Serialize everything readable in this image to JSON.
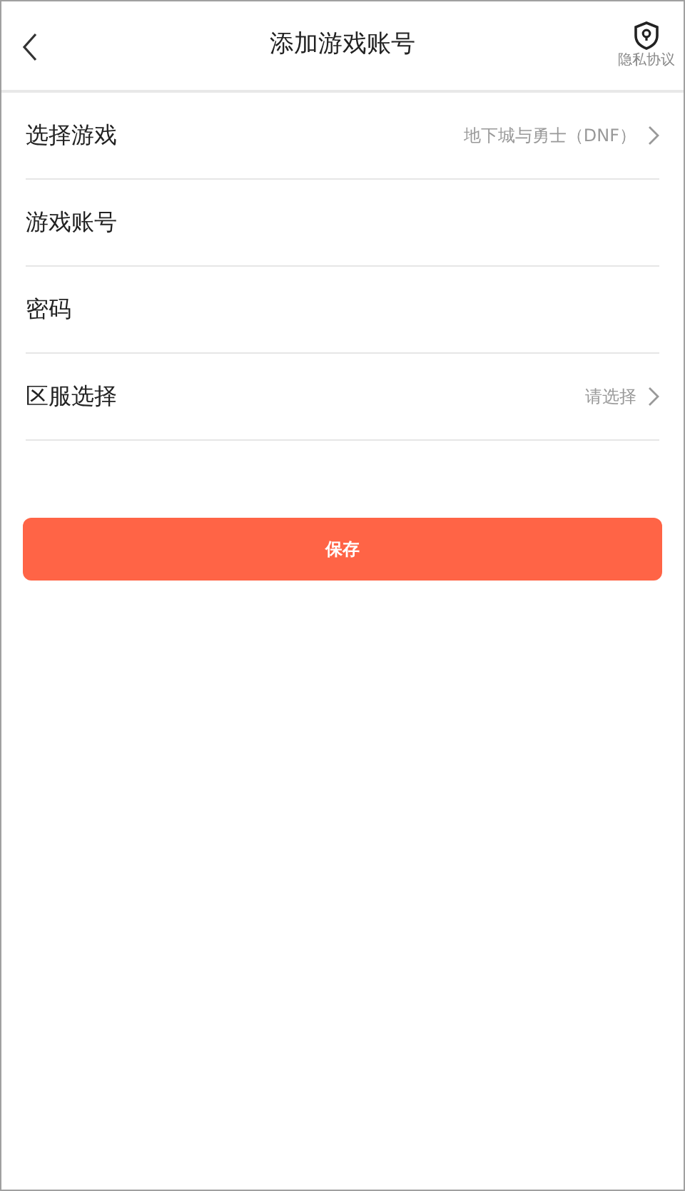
{
  "header": {
    "title": "添加游戏账号",
    "privacy_label": "隐私协议"
  },
  "form_rows": [
    {
      "kind": "select",
      "label": "选择游戏",
      "value": "地下城与勇士（DNF）"
    },
    {
      "kind": "input",
      "label": "游戏账号"
    },
    {
      "kind": "input",
      "label": "密码"
    },
    {
      "kind": "select",
      "label": "区服选择",
      "value": "请选择"
    }
  ],
  "save_button": "保存"
}
